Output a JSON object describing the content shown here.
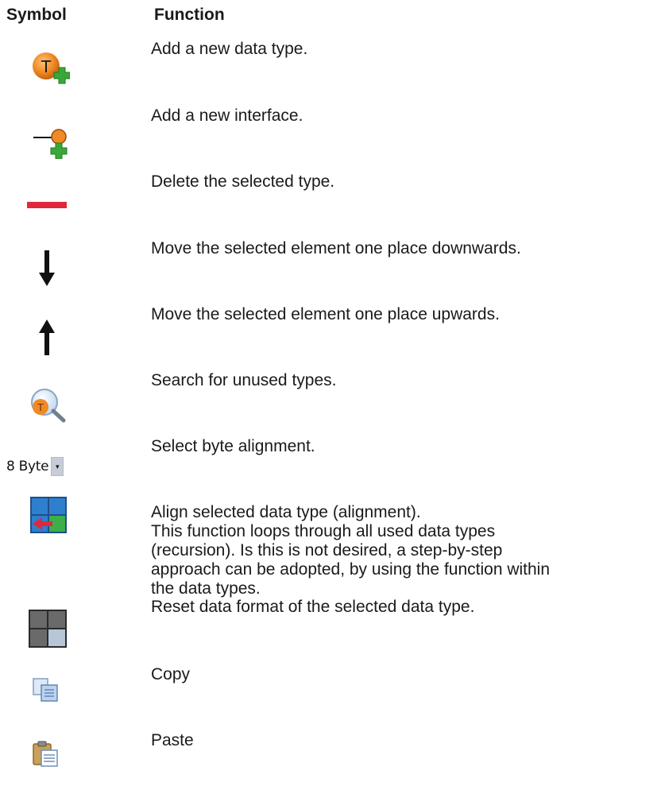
{
  "header": {
    "symbol": "Symbol",
    "function": "Function"
  },
  "rows": [
    {
      "icon": "add-data-type-icon",
      "lines": [
        "Add a new data type."
      ]
    },
    {
      "icon": "add-interface-icon",
      "lines": [
        "Add a new interface."
      ]
    },
    {
      "icon": "delete-icon",
      "lines": [
        "Delete the selected type."
      ]
    },
    {
      "icon": "arrow-down-icon",
      "lines": [
        "Move the selected element one place downwards."
      ]
    },
    {
      "icon": "arrow-up-icon",
      "lines": [
        "Move the selected element one place upwards."
      ]
    },
    {
      "icon": "search-unused-types-icon",
      "lines": [
        "Search for unused types."
      ]
    },
    {
      "icon": "byte-alignment-select",
      "lines": [
        "Select byte alignment."
      ]
    },
    {
      "icon": "align-data-type-icon",
      "lines": [
        "Align selected data type (alignment).",
        "This function loops through all used data types",
        "(recursion). Is this is not desired, a step-by-step",
        "approach can be adopted, by using the function within",
        "the data types."
      ]
    },
    {
      "icon": "reset-data-format-icon",
      "lines": [
        "Reset data format of the selected data type."
      ]
    },
    {
      "icon": "copy-icon",
      "lines": [
        "Copy"
      ]
    },
    {
      "icon": "paste-icon",
      "lines": [
        "Paste"
      ]
    }
  ],
  "byte_alignment": {
    "value": "8 Byte",
    "dropdown_glyph": "▾"
  },
  "colors": {
    "orange": "#f08a24",
    "green": "#3aa83a",
    "red": "#e0283c",
    "blue": "#2f6fb8"
  }
}
